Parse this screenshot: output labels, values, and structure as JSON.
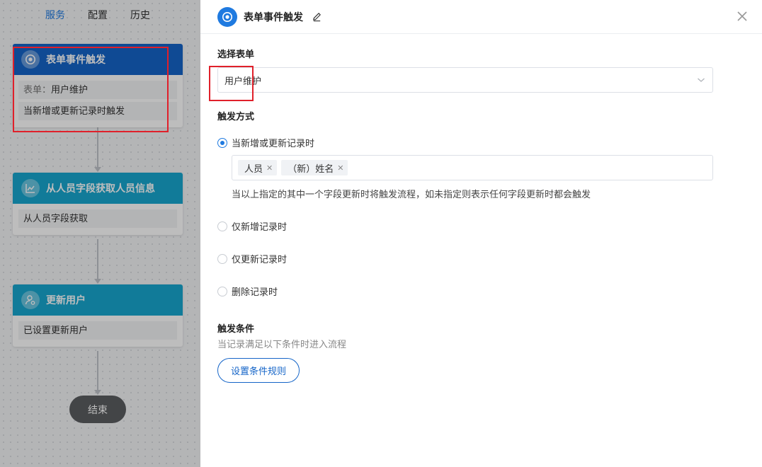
{
  "nav": {
    "tabs": [
      "服务",
      "配置",
      "历史"
    ],
    "active": 0
  },
  "flow": {
    "nodes": [
      {
        "title": "表单事件触发",
        "icon": "target-icon",
        "color": "#1565c8",
        "rows": [
          {
            "label": "表单：",
            "value": "用户维护"
          },
          {
            "value": "当新增或更新记录时触发"
          }
        ]
      },
      {
        "title": "从人员字段获取人员信息",
        "icon": "trend-chart-icon",
        "color": "#18a6cf",
        "rows": [
          {
            "value": "从人员字段获取"
          }
        ]
      },
      {
        "title": "更新用户",
        "icon": "user-settings-icon",
        "color": "#18a6cf",
        "rows": [
          {
            "value": "已设置更新用户"
          }
        ]
      }
    ],
    "end_label": "结束"
  },
  "drawer": {
    "title": "表单事件触发",
    "form_section": {
      "label": "选择表单",
      "selected": "用户维护"
    },
    "trigger_section": {
      "label": "触发方式",
      "options": [
        "当新增或更新记录时",
        "仅新增记录时",
        "仅更新记录时",
        "删除记录时"
      ],
      "selected_index": 0,
      "fields": [
        "人员",
        "（新）姓名"
      ],
      "hint": "当以上指定的其中一个字段更新时将触发流程，如未指定则表示任何字段更新时都会触发"
    },
    "condition_section": {
      "label": "触发条件",
      "hint": "当记录满足以下条件时进入流程",
      "button": "设置条件规则"
    }
  },
  "colors": {
    "accent": "#1f7ae0",
    "node_blue": "#1565c8",
    "node_cyan": "#18a6cf",
    "highlight": "#e0202a"
  }
}
